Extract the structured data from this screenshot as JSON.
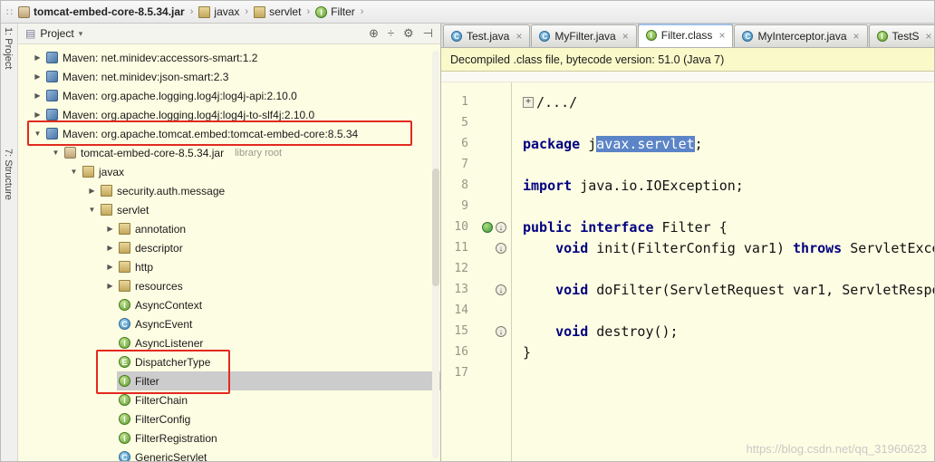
{
  "icons": {
    "grip": "∷",
    "sep": "›",
    "caret": "▾",
    "expand": "▶",
    "collapse": "▼",
    "close": "×",
    "fold_plus": "+",
    "implemented": "↓",
    "panel": "▤",
    "locate": "⊕",
    "collapse_all": "÷",
    "settings": "⚙",
    "hide": "⊣"
  },
  "colors": {
    "editor_background": "#FDFDE3",
    "notification_background": "#F9F9CA",
    "selection_blue": "#5C85C7",
    "annotation_red": "#E22A1F",
    "keyword_navy": "#000080"
  },
  "breadcrumb": {
    "items": [
      {
        "label": "tomcat-embed-core-8.5.34.jar",
        "icon": "jar",
        "bold": true
      },
      {
        "label": "javax",
        "icon": "package"
      },
      {
        "label": "servlet",
        "icon": "package"
      },
      {
        "label": "Filter",
        "icon": "interface"
      }
    ]
  },
  "left_rail": {
    "top": "1: Project",
    "bottom": "7: Structure"
  },
  "project_panel": {
    "title": "Project",
    "tree": [
      {
        "level": 0,
        "arrow": "right",
        "icon": "maven",
        "label": "Maven: net.minidev:accessors-smart:1.2"
      },
      {
        "level": 0,
        "arrow": "right",
        "icon": "maven",
        "label": "Maven: net.minidev:json-smart:2.3"
      },
      {
        "level": 0,
        "arrow": "right",
        "icon": "maven",
        "label": "Maven: org.apache.logging.log4j:log4j-api:2.10.0"
      },
      {
        "level": 0,
        "arrow": "right",
        "icon": "maven",
        "label": "Maven: org.apache.logging.log4j:log4j-to-slf4j:2.10.0"
      },
      {
        "level": 0,
        "arrow": "down",
        "icon": "maven",
        "label": "Maven: org.apache.tomcat.embed:tomcat-embed-core:8.5.34"
      },
      {
        "level": 1,
        "arrow": "down",
        "icon": "jar",
        "label": "tomcat-embed-core-8.5.34.jar",
        "extra": "library root"
      },
      {
        "level": 2,
        "arrow": "down",
        "icon": "package",
        "label": "javax"
      },
      {
        "level": 3,
        "arrow": "right",
        "icon": "package",
        "label": "security.auth.message"
      },
      {
        "level": 3,
        "arrow": "down",
        "icon": "package",
        "label": "servlet"
      },
      {
        "level": 4,
        "arrow": "right",
        "icon": "package",
        "label": "annotation"
      },
      {
        "level": 4,
        "arrow": "right",
        "icon": "package",
        "label": "descriptor"
      },
      {
        "level": 4,
        "arrow": "right",
        "icon": "package",
        "label": "http"
      },
      {
        "level": 4,
        "arrow": "right",
        "icon": "package",
        "label": "resources"
      },
      {
        "level": 4,
        "icon": "interface",
        "label": "AsyncContext"
      },
      {
        "level": 4,
        "icon": "class",
        "label": "AsyncEvent"
      },
      {
        "level": 4,
        "icon": "interface",
        "label": "AsyncListener"
      },
      {
        "level": 4,
        "icon": "enum",
        "label": "DispatcherType"
      },
      {
        "level": 4,
        "icon": "interface",
        "label": "Filter",
        "selected": true
      },
      {
        "level": 4,
        "icon": "interface",
        "label": "FilterChain"
      },
      {
        "level": 4,
        "icon": "interface",
        "label": "FilterConfig"
      },
      {
        "level": 4,
        "icon": "interface",
        "label": "FilterRegistration"
      },
      {
        "level": 4,
        "icon": "class",
        "label": "GenericServlet"
      }
    ]
  },
  "editor": {
    "tabs": [
      {
        "label": "Test.java",
        "icon": "class",
        "active": false
      },
      {
        "label": "MyFilter.java",
        "icon": "class",
        "active": false
      },
      {
        "label": "Filter.class",
        "icon": "interface",
        "active": true
      },
      {
        "label": "MyInterceptor.java",
        "icon": "class",
        "active": false
      },
      {
        "label": "TestS",
        "icon": "interface",
        "active": false
      }
    ],
    "notification": "Decompiled .class file, bytecode version: 51.0 (Java 7)",
    "code": {
      "lines": [
        {
          "n": "1",
          "fold": true,
          "seg": [
            {
              "t": "/.../",
              "s": "p"
            }
          ]
        },
        {
          "n": "5",
          "seg": []
        },
        {
          "n": "6",
          "seg": [
            {
              "t": "package ",
              "s": "k"
            },
            {
              "t": "j",
              "s": "p"
            },
            {
              "t": "avax.servlet",
              "s": "sel"
            },
            {
              "t": ";",
              "s": "p"
            }
          ]
        },
        {
          "n": "7",
          "seg": []
        },
        {
          "n": "8",
          "seg": [
            {
              "t": "import ",
              "s": "k"
            },
            {
              "t": "java.io.IOException;",
              "s": "p"
            }
          ]
        },
        {
          "n": "9",
          "seg": []
        },
        {
          "n": "10",
          "markers": [
            "globe",
            "impl"
          ],
          "seg": [
            {
              "t": "public interface ",
              "s": "k"
            },
            {
              "t": "Filter {",
              "s": "p"
            }
          ]
        },
        {
          "n": "11",
          "markers": [
            "impl"
          ],
          "seg": [
            {
              "t": "    ",
              "s": "p"
            },
            {
              "t": "void ",
              "s": "k"
            },
            {
              "t": "init(FilterConfig var1) ",
              "s": "p"
            },
            {
              "t": "throws ",
              "s": "k"
            },
            {
              "t": "ServletExce",
              "s": "p"
            }
          ]
        },
        {
          "n": "12",
          "seg": []
        },
        {
          "n": "13",
          "markers": [
            "impl"
          ],
          "seg": [
            {
              "t": "    ",
              "s": "p"
            },
            {
              "t": "void ",
              "s": "k"
            },
            {
              "t": "doFilter(ServletRequest var1, ServletRespo",
              "s": "p"
            }
          ]
        },
        {
          "n": "14",
          "seg": []
        },
        {
          "n": "15",
          "markers": [
            "impl"
          ],
          "seg": [
            {
              "t": "    ",
              "s": "p"
            },
            {
              "t": "void ",
              "s": "k"
            },
            {
              "t": "destroy();",
              "s": "p"
            }
          ]
        },
        {
          "n": "16",
          "seg": [
            {
              "t": "}",
              "s": "p"
            }
          ]
        },
        {
          "n": "17",
          "seg": []
        }
      ]
    }
  },
  "watermark": "https://blog.csdn.net/qq_31960623"
}
